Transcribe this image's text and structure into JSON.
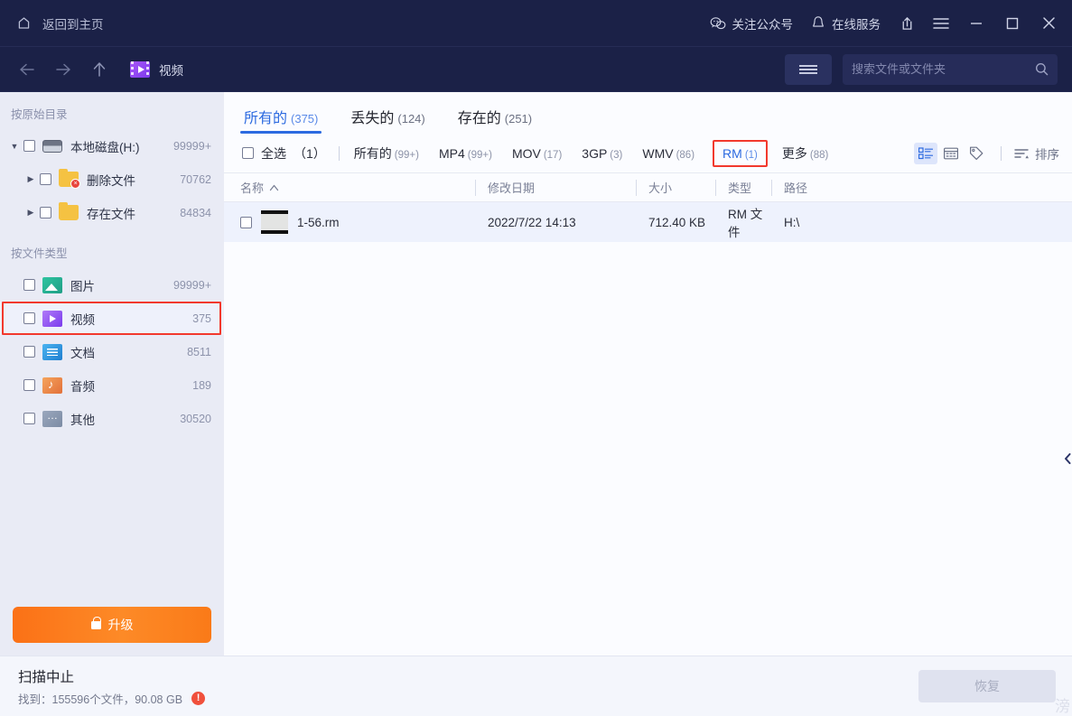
{
  "titlebar": {
    "home_label": "返回到主页",
    "home_icon": "home-icon",
    "follow_label": "关注公众号",
    "follow_icon": "wechat-icon",
    "service_label": "在线服务",
    "service_icon": "bell-icon",
    "share_icon": "share-icon",
    "menu_icon": "hamburger-icon",
    "minimize_icon": "minimize-icon",
    "maximize_icon": "maximize-icon",
    "close_icon": "close-icon"
  },
  "navbar": {
    "back_icon": "arrow-left-icon",
    "forward_icon": "arrow-right-icon",
    "up_icon": "arrow-up-icon",
    "breadcrumb": "视频",
    "breadcrumb_icon": "video-folder-icon",
    "list_toggle_icon": "list-lines-icon",
    "search_placeholder": "搜索文件或文件夹",
    "search_value": "",
    "search_icon": "search-icon"
  },
  "sidebar": {
    "section_tree_title": "按原始目录",
    "tree": [
      {
        "label": "本地磁盘(H:)",
        "count": "99999+",
        "icon": "disk-icon",
        "expanded": true,
        "level": 1
      },
      {
        "label": "删除文件",
        "count": "70762",
        "icon": "folder-deleted-icon",
        "expanded": false,
        "level": 2
      },
      {
        "label": "存在文件",
        "count": "84834",
        "icon": "folder-icon",
        "expanded": false,
        "level": 2
      }
    ],
    "section_type_title": "按文件类型",
    "types": [
      {
        "label": "图片",
        "count": "99999+",
        "icon": "image-icon",
        "selected": false
      },
      {
        "label": "视频",
        "count": "375",
        "icon": "video-icon",
        "selected": true
      },
      {
        "label": "文档",
        "count": "8511",
        "icon": "document-icon",
        "selected": false
      },
      {
        "label": "音频",
        "count": "189",
        "icon": "audio-icon",
        "selected": false
      },
      {
        "label": "其他",
        "count": "30520",
        "icon": "other-icon",
        "selected": false
      }
    ],
    "upgrade_label": "升级",
    "upgrade_icon": "lock-icon"
  },
  "main": {
    "tabs": [
      {
        "label": "所有的",
        "count": "(375)",
        "active": true
      },
      {
        "label": "丢失的",
        "count": "(124)",
        "active": false
      },
      {
        "label": "存在的",
        "count": "(251)",
        "active": false
      }
    ],
    "select_all_label": "全选",
    "select_all_count": "（1）",
    "filters": [
      {
        "label": "所有的",
        "count": "(99+)",
        "active": false,
        "highlight": false
      },
      {
        "label": "MP4",
        "count": "(99+)",
        "active": false,
        "highlight": false
      },
      {
        "label": "MOV",
        "count": "(17)",
        "active": false,
        "highlight": false
      },
      {
        "label": "3GP",
        "count": "(3)",
        "active": false,
        "highlight": false
      },
      {
        "label": "WMV",
        "count": "(86)",
        "active": false,
        "highlight": false
      },
      {
        "label": "RM",
        "count": "(1)",
        "active": true,
        "highlight": true
      },
      {
        "label": "更多",
        "count": "(88)",
        "active": false,
        "highlight": false
      }
    ],
    "view_icons": [
      "grid-list-icon",
      "thumbnail-icon",
      "tag-icon"
    ],
    "sort_label": "排序",
    "sort_icon": "sort-icon",
    "columns": [
      "名称",
      "修改日期",
      "大小",
      "类型",
      "路径"
    ],
    "sort_indicator": "▲",
    "rows": [
      {
        "name": "1-56.rm",
        "date": "2022/7/22 14:13",
        "size": "712.40 KB",
        "type": "RM 文件",
        "path": "H:\\",
        "thumb_icon": "film-placeholder-icon"
      }
    ]
  },
  "footer": {
    "status_title": "扫描中止",
    "status_detail": "找到：155596个文件，90.08 GB",
    "warning_icon": "warning-icon",
    "recover_label": "恢复",
    "watermark": "滂"
  },
  "colors": {
    "header_bg": "#1b2147",
    "sidebar_bg": "#e9ebf5",
    "accent_blue": "#2c6ae0",
    "highlight_red": "#f2392d",
    "upgrade_orange": "#fb7116",
    "row_selected": "#eef2fd"
  }
}
